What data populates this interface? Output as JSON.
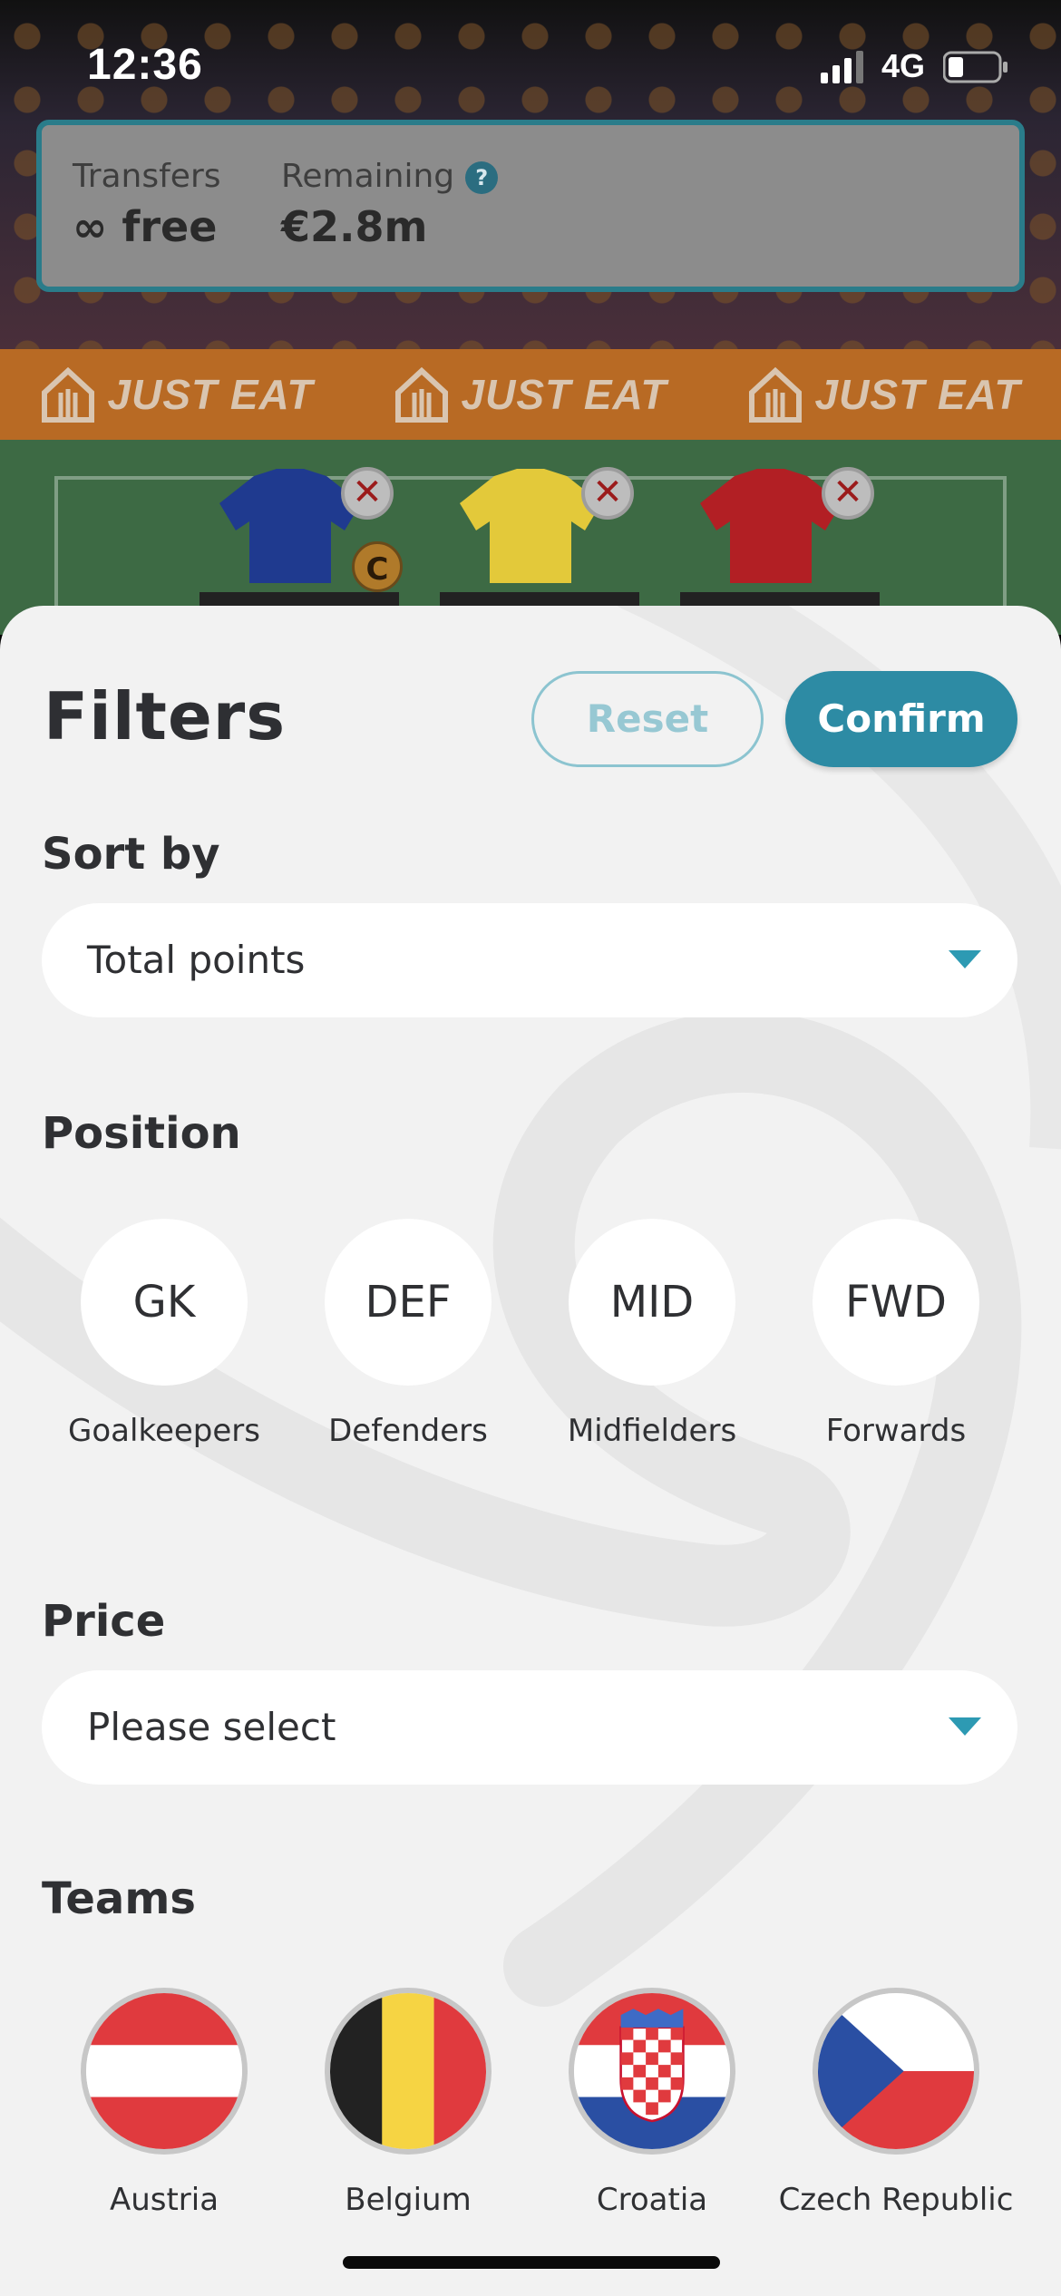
{
  "status_bar": {
    "time": "12:36",
    "network": "4G"
  },
  "transfers": {
    "transfers_label": "Transfers",
    "transfers_value": "∞ free",
    "remaining_label": "Remaining",
    "remaining_value": "€2.8m",
    "help_symbol": "?"
  },
  "sponsor": {
    "text": "JUST EAT",
    "repeat": 3
  },
  "squad": {
    "captain_badge": "C",
    "remove_symbol": "✕",
    "players": [
      {
        "shirt_color": "#1f3a8f"
      },
      {
        "shirt_color": "#e3c93a"
      },
      {
        "shirt_color": "#b21f24"
      }
    ]
  },
  "filters": {
    "title": "Filters",
    "reset_label": "Reset",
    "confirm_label": "Confirm",
    "sort_by": {
      "label": "Sort by",
      "selected": "Total points"
    },
    "position": {
      "label": "Position",
      "items": [
        {
          "abbr": "GK",
          "name": "Goalkeepers"
        },
        {
          "abbr": "DEF",
          "name": "Defenders"
        },
        {
          "abbr": "MID",
          "name": "Midfielders"
        },
        {
          "abbr": "FWD",
          "name": "Forwards"
        }
      ]
    },
    "price": {
      "label": "Price",
      "selected": "Please select"
    },
    "teams": {
      "label": "Teams",
      "items": [
        {
          "name": "Austria"
        },
        {
          "name": "Belgium"
        },
        {
          "name": "Croatia"
        },
        {
          "name": "Czech Republic"
        }
      ]
    }
  },
  "colors": {
    "accent": "#2d8ba4",
    "reset_border": "#8cc4d0",
    "sheet_bg": "#f2f2f2",
    "sponsor_band": "#b86a24"
  }
}
